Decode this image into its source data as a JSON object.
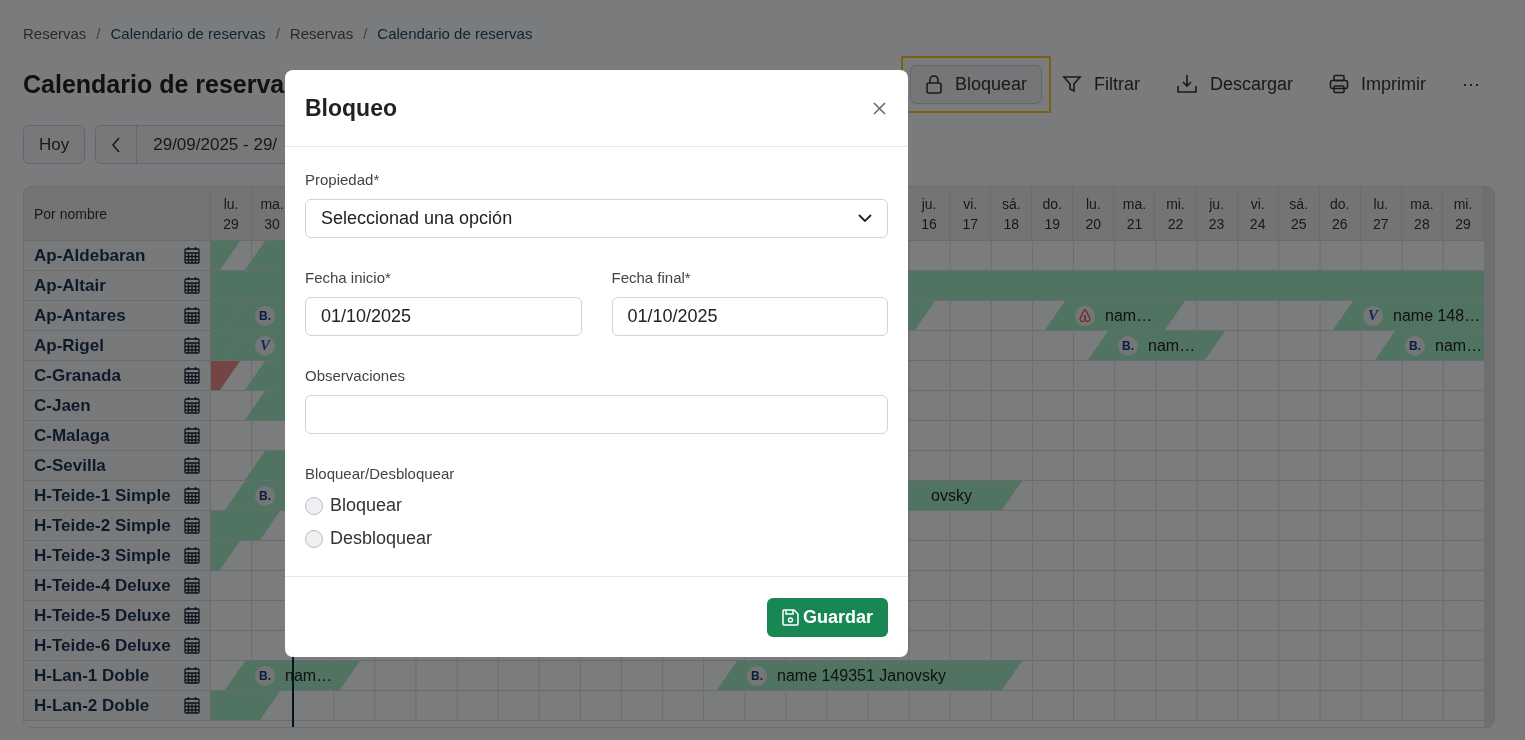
{
  "breadcrumb": [
    {
      "kind": "crumb",
      "label": "Reservas",
      "active": false
    },
    {
      "kind": "separator",
      "label": "/"
    },
    {
      "kind": "crumb",
      "label": "Calendario de reservas",
      "active": true
    },
    {
      "kind": "separator",
      "label": "/"
    },
    {
      "kind": "crumb",
      "label": "Reservas",
      "active": false
    },
    {
      "kind": "separator",
      "label": "/"
    },
    {
      "kind": "crumb",
      "label": "Calendario de reservas",
      "active": true
    }
  ],
  "title": "Calendario de reserva",
  "toolbar": [
    {
      "kind": "lock",
      "label": "Bloquear",
      "highlighted": true
    },
    {
      "kind": "filter",
      "label": "Filtrar",
      "highlighted": false
    },
    {
      "kind": "download",
      "label": "Descargar",
      "highlighted": false
    },
    {
      "kind": "print",
      "label": "Imprimir",
      "highlighted": false
    },
    {
      "kind": "more",
      "label": "⋯",
      "highlighted": false
    }
  ],
  "date_nav": {
    "today": "Hoy",
    "range": "29/09/2025 - 29/"
  },
  "calendar": {
    "name_header": "Por nombre",
    "days": [
      {
        "weekday": "lu.",
        "day": "29"
      },
      {
        "weekday": "ma.",
        "day": "30"
      },
      {
        "weekday": "ju.",
        "day": "16"
      },
      {
        "weekday": "vi.",
        "day": "17"
      },
      {
        "weekday": "sá.",
        "day": "18"
      },
      {
        "weekday": "do.",
        "day": "19"
      },
      {
        "weekday": "lu.",
        "day": "20"
      },
      {
        "weekday": "ma.",
        "day": "21"
      },
      {
        "weekday": "mi.",
        "day": "22"
      },
      {
        "weekday": "ju.",
        "day": "23"
      },
      {
        "weekday": "vi.",
        "day": "24"
      },
      {
        "weekday": "sá.",
        "day": "25"
      },
      {
        "weekday": "do.",
        "day": "26"
      },
      {
        "weekday": "lu.",
        "day": "27"
      },
      {
        "weekday": "ma.",
        "day": "28"
      },
      {
        "weekday": "mi.",
        "day": "29"
      }
    ],
    "rows": [
      {
        "name": "Ap-Aldebaran",
        "bookings": [
          {
            "kind": "reservation"
          },
          {
            "kind": "reservation"
          }
        ]
      },
      {
        "name": "Ap-Altair",
        "bookings": [
          {
            "kind": "reservation"
          }
        ]
      },
      {
        "name": "Ap-Antares",
        "bookings": [
          {
            "kind": "reservation"
          },
          {
            "kind": "reservation",
            "logo": {
              "kind": "booking",
              "text": "B."
            }
          },
          {
            "kind": "reservation",
            "logo": {
              "kind": "airbnb"
            },
            "name": "nam…"
          },
          {
            "kind": "reservation",
            "logo": {
              "kind": "vrbo",
              "text": "V"
            },
            "name": "name 148…"
          }
        ]
      },
      {
        "name": "Ap-Rigel",
        "bookings": [
          {
            "kind": "reservation"
          },
          {
            "kind": "reservation",
            "logo": {
              "kind": "vrbo",
              "text": "V"
            }
          },
          {
            "kind": "reservation",
            "logo": {
              "kind": "booking",
              "text": "B."
            },
            "name": "nam…"
          },
          {
            "kind": "reservation",
            "logo": {
              "kind": "booking",
              "text": "B."
            },
            "name": "nam…"
          }
        ]
      },
      {
        "name": "C-Granada",
        "bookings": [
          {
            "kind": "block"
          },
          {
            "kind": "reservation"
          }
        ]
      },
      {
        "name": "C-Jaen",
        "bookings": [
          {
            "kind": "reservation"
          }
        ]
      },
      {
        "name": "C-Malaga"
      },
      {
        "name": "C-Sevilla",
        "bookings": [
          {
            "kind": "reservation"
          }
        ]
      },
      {
        "name": "H-Teide-1 Simple",
        "bookings": [
          {
            "kind": "reservation",
            "logo": {
              "kind": "booking",
              "text": "B."
            }
          },
          {
            "kind": "reservation",
            "name": "ovsky"
          }
        ]
      },
      {
        "name": "H-Teide-2 Simple",
        "bookings": [
          {
            "kind": "reservation"
          }
        ]
      },
      {
        "name": "H-Teide-3 Simple",
        "bookings": [
          {
            "kind": "reservation"
          }
        ]
      },
      {
        "name": "H-Teide-4 Deluxe"
      },
      {
        "name": "H-Teide-5 Deluxe"
      },
      {
        "name": "H-Teide-6 Deluxe"
      },
      {
        "name": "H-Lan-1 Doble",
        "bookings": [
          {
            "kind": "reservation",
            "logo": {
              "kind": "booking",
              "text": "B."
            },
            "name": "nam…"
          },
          {
            "kind": "reservation",
            "logo": {
              "kind": "booking",
              "text": "B."
            },
            "name": "name 149351 Janovsky"
          }
        ]
      },
      {
        "name": "H-Lan-2 Doble",
        "bookings": [
          {
            "kind": "reservation"
          }
        ]
      }
    ]
  },
  "modal": {
    "title": "Bloqueo",
    "fields": [
      {
        "kind": "select",
        "label": "Propiedad*",
        "value": "Seleccionad una opción"
      },
      {
        "kind": "date",
        "label": "Fecha inicio*",
        "value": "01/10/2025"
      },
      {
        "kind": "date",
        "label": "Fecha final*",
        "value": "01/10/2025"
      },
      {
        "kind": "text",
        "label": "Observaciones"
      }
    ],
    "radio_group": {
      "label": "Bloquear/Desbloquear",
      "options": [
        {
          "label": "Bloquear",
          "selected": false
        },
        {
          "label": "Desbloquear",
          "selected": false
        }
      ]
    },
    "save": "Guardar"
  }
}
